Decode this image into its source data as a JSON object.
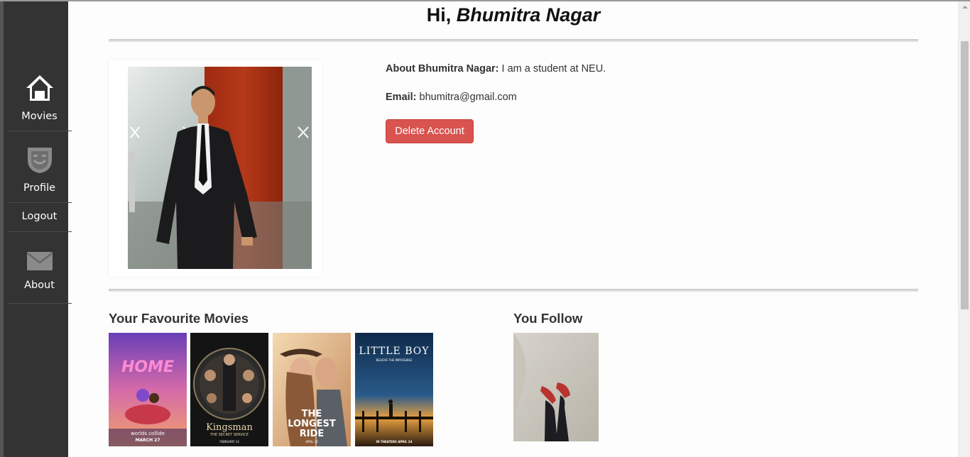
{
  "sidebar": {
    "items": [
      {
        "label": "Movies",
        "icon": "home-icon"
      },
      {
        "label": "Profile",
        "icon": "face-shield-icon"
      },
      {
        "label": "Logout"
      },
      {
        "label": "About",
        "icon": "envelope-icon"
      }
    ]
  },
  "header": {
    "greeting_prefix": "Hi, ",
    "user_name": "Bhumitra Nagar"
  },
  "profile": {
    "about_label": "About Bhumitra Nagar:",
    "about_text": " I am a student at NEU.",
    "email_label": "Email:",
    "email_value": " bhumitra@gmail.com",
    "delete_button": "Delete Account"
  },
  "favourites": {
    "title": "Your Favourite Movies",
    "movies": [
      {
        "title": "HOME",
        "tagline": "worlds collide",
        "date": "MARCH 27"
      },
      {
        "title": "Kingsman",
        "tagline": "THE SECRET SERVICE",
        "date": "FEBRUARY 13"
      },
      {
        "title": "THE LONGEST RIDE",
        "tagline": "",
        "date": "APRIL 10"
      },
      {
        "title": "LITTLE BOY",
        "tagline": "BELIEVE THE IMPOSSIBLE",
        "date": "IN THEATERS APRIL 24"
      }
    ]
  },
  "following": {
    "title": "You Follow"
  },
  "colors": {
    "sidebar_bg": "#333333",
    "danger": "#d9534f"
  }
}
